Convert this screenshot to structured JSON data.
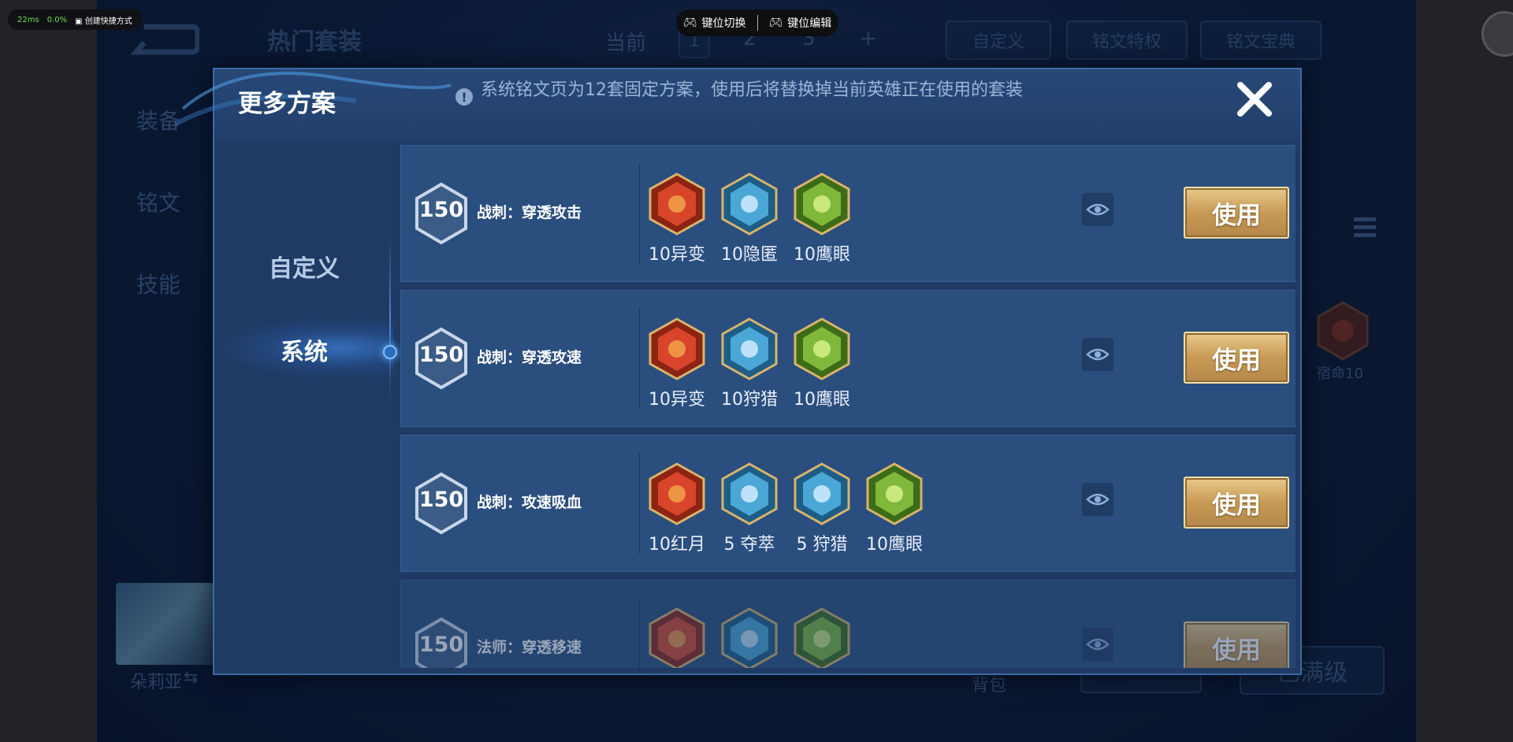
{
  "overlay": {
    "latency": "22ms",
    "loss": "0.0%",
    "shortcut_label": "创建快捷方式",
    "key_switch_label": "键位切换",
    "key_edit_label": "键位编辑"
  },
  "background": {
    "title": "热门套装",
    "current_label": "当前",
    "pages": [
      "1",
      "2",
      "3",
      "+"
    ],
    "custom_label": "自定义",
    "privilege_label": "铭文特权",
    "treasure_label": "铭文宝典",
    "left_tabs": [
      "装备",
      "铭文",
      "技能"
    ],
    "hero_name": "朵莉亚",
    "bag_label": "背包",
    "maxed_label": "已满级",
    "right_rune_label": "宿命10"
  },
  "dialog": {
    "title": "更多方案",
    "notice": "系统铭文页为12套固定方案，使用后将替换掉当前英雄正在使用的套装",
    "tabs": [
      {
        "label": "自定义",
        "active": false
      },
      {
        "label": "系统",
        "active": true
      }
    ],
    "plans": [
      {
        "level": "150",
        "name": "战刺：穿透攻击",
        "runes": [
          {
            "label": "10异变",
            "icon": "rune-red-icon"
          },
          {
            "label": "10隐匿",
            "icon": "rune-blue-icon"
          },
          {
            "label": "10鹰眼",
            "icon": "rune-green-icon"
          }
        ],
        "use_label": "使用"
      },
      {
        "level": "150",
        "name": "战刺：穿透攻速",
        "runes": [
          {
            "label": "10异变",
            "icon": "rune-red-icon"
          },
          {
            "label": "10狩猎",
            "icon": "rune-blue-icon"
          },
          {
            "label": "10鹰眼",
            "icon": "rune-green-icon"
          }
        ],
        "use_label": "使用"
      },
      {
        "level": "150",
        "name": "战刺：攻速吸血",
        "runes": [
          {
            "label": "10红月",
            "icon": "rune-red-icon"
          },
          {
            "label": "5 夺萃",
            "icon": "rune-blue-icon"
          },
          {
            "label": "5 狩猎",
            "icon": "rune-blue-icon"
          },
          {
            "label": "10鹰眼",
            "icon": "rune-green-icon"
          }
        ],
        "use_label": "使用"
      },
      {
        "level": "150",
        "name": "法师：穿透移速",
        "runes": [
          {
            "label": "",
            "icon": "rune-red-icon"
          },
          {
            "label": "",
            "icon": "rune-blue-icon"
          },
          {
            "label": "",
            "icon": "rune-green-icon"
          }
        ],
        "use_label": "使用"
      }
    ]
  },
  "colors": {
    "dialog_bg": "#1f3a63",
    "row_bg": "#2a4e7e",
    "use_button": "#c79a55",
    "red_rune": "#d8452a",
    "blue_rune": "#4aa7d6",
    "green_rune": "#7fb83a"
  }
}
